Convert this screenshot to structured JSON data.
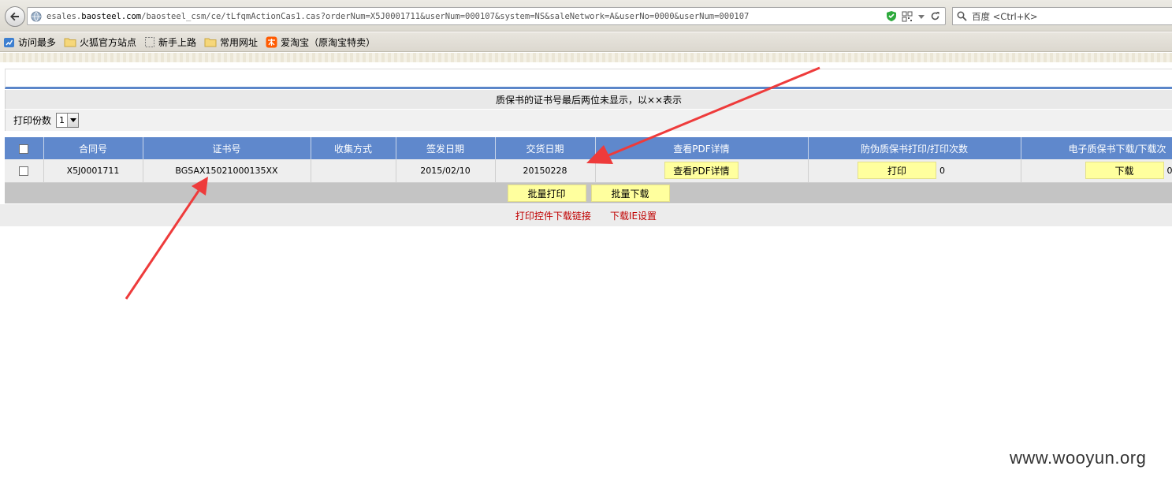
{
  "browser": {
    "url_prefix": "esales.",
    "url_domain": "baosteel.com",
    "url_path": "/baosteel_csm/ce/tLfqmActionCas1.cas?orderNum=X5J0001711&userNum=000107&system=NS&saleNetwork=A&userNo=0000&userNum=000107",
    "search_placeholder": "百度 <Ctrl+K>",
    "bookmarks": [
      {
        "label": "访问最多",
        "icon": "bookmark-star-icon"
      },
      {
        "label": "火狐官方站点",
        "icon": "folder-icon"
      },
      {
        "label": "新手上路",
        "icon": "page-icon"
      },
      {
        "label": "常用网址",
        "icon": "folder-icon"
      },
      {
        "label": "爱淘宝（原淘宝特卖）",
        "icon": "taobao-icon"
      }
    ]
  },
  "page": {
    "notice": "质保书的证书号最后两位未显示，以××表示",
    "copies_label": "打印份数",
    "copies_value": "1",
    "table": {
      "headers": [
        "合同号",
        "证书号",
        "收集方式",
        "签发日期",
        "交货日期",
        "查看PDF详情",
        "防伪质保书打印/打印次数",
        "电子质保书下载/下载次"
      ],
      "rows": [
        {
          "contract": "X5J0001711",
          "certificate": "BGSAX15021000135XX",
          "collect_method": "",
          "issue_date": "2015/02/10",
          "delivery_date": "20150228",
          "pdf_button": "查看PDF详情",
          "print_button": "打印",
          "print_count": "0",
          "download_button": "下载",
          "download_count": "0"
        }
      ]
    },
    "batch_print": "批量打印",
    "batch_download": "批量下载",
    "link_print_control": "打印控件下载链接",
    "link_ie_settings": "下载IE设置"
  },
  "watermark": "www.wooyun.org",
  "colors": {
    "header_blue": "#5f88cc",
    "button_yellow": "#ffff9e",
    "link_red": "#c00000",
    "arrow_red": "#ee3b3b"
  }
}
